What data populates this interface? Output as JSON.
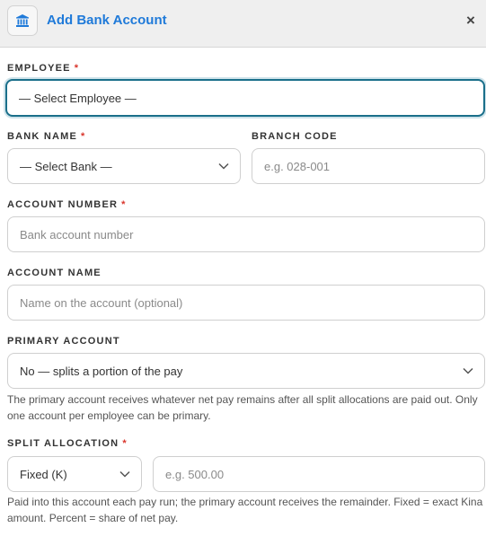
{
  "dialog": {
    "title": "Add Bank Account",
    "header_icon": "bank-icon",
    "close_icon": "×"
  },
  "fields": {
    "employee": {
      "label": "EMPLOYEE",
      "required": "*",
      "value": "— Select Employee —"
    },
    "bank_name": {
      "label": "BANK NAME",
      "required": "*",
      "value": "— Select Bank —"
    },
    "branch_code": {
      "label": "BRANCH CODE",
      "placeholder": "e.g. 028-001"
    },
    "account_number": {
      "label": "ACCOUNT NUMBER",
      "required": "*",
      "placeholder": "Bank account number"
    },
    "account_name": {
      "label": "ACCOUNT NAME",
      "placeholder": "Name on the account (optional)"
    },
    "primary_account": {
      "label": "PRIMARY ACCOUNT",
      "value": "No — splits a portion of the pay",
      "help": "The primary account receives whatever net pay remains after all split allocations are paid out. Only one account per employee can be primary."
    },
    "split_allocation": {
      "label": "SPLIT ALLOCATION",
      "required": "*",
      "type_value": "Fixed (K)",
      "amount_placeholder": "e.g. 500.00",
      "help": "Paid into this account each pay run; the primary account receives the remainder. Fixed = exact Kina amount. Percent = share of net pay."
    }
  },
  "colors": {
    "accent": "#1f7ad9",
    "required": "#d9342b",
    "focus_border": "#1a6f8a"
  }
}
